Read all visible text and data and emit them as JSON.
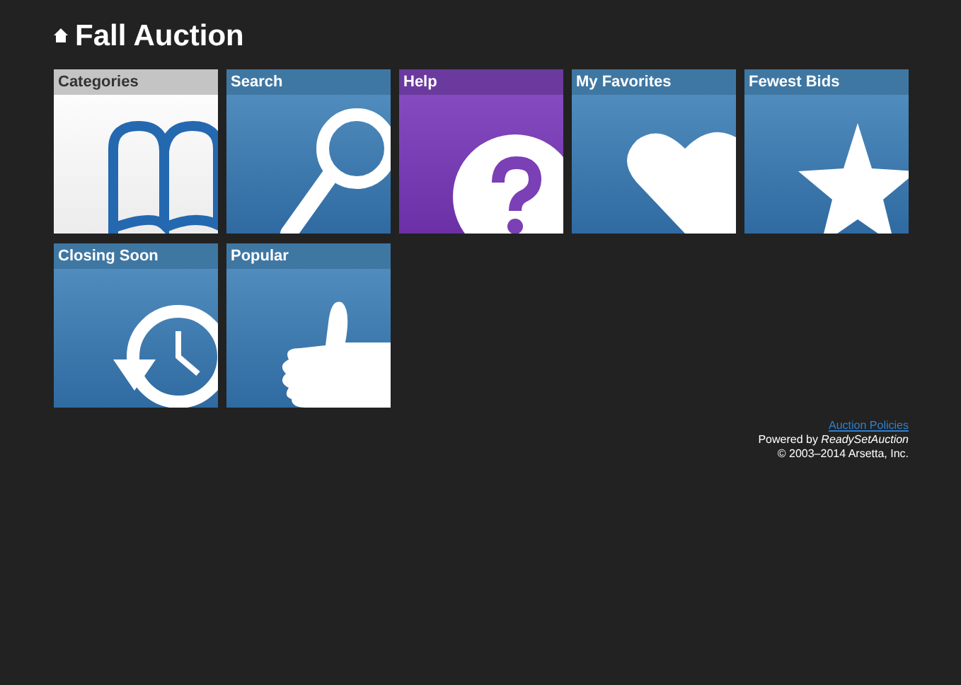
{
  "title": "Fall Auction",
  "tiles": [
    {
      "label": "Categories",
      "kind": "light"
    },
    {
      "label": "Search",
      "kind": "blue"
    },
    {
      "label": "Help",
      "kind": "purple"
    },
    {
      "label": "My Favorites",
      "kind": "blue"
    },
    {
      "label": "Fewest Bids",
      "kind": "blue"
    },
    {
      "label": "Closing Soon",
      "kind": "blue"
    },
    {
      "label": "Popular",
      "kind": "blue"
    }
  ],
  "footer": {
    "link": "Auction Policies",
    "powered": "Powered by *ReadySetAuction*",
    "copyright": "© 2003–2014 Arsetta, Inc."
  }
}
